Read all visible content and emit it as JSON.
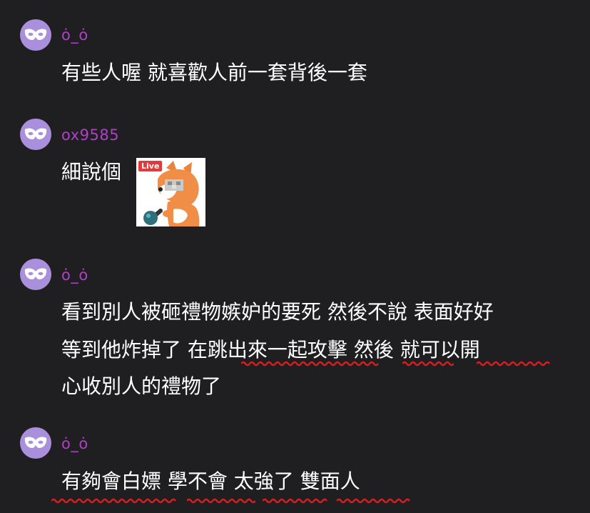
{
  "messages": [
    {
      "username": "ȯ_ȯ",
      "lines": [
        "有些人喔 就喜歡人前一套背後一套"
      ]
    },
    {
      "username": "ox9585",
      "lines": [
        "細說個"
      ],
      "sticker": {
        "badge": "Live",
        "icon": "fox-microphone-sticker"
      }
    },
    {
      "username": "ȯ_ȯ",
      "lines": [
        "看到別人被砸禮物嫉妒的要死 然後不說 表面好好",
        "等到他炸掉了 在跳出來一起攻擊 然後 就可以開",
        "心收別人的禮物了"
      ]
    },
    {
      "username": "ȯ_ȯ",
      "lines": [
        "有夠會白嫖 學不會 太強了 雙面人"
      ]
    }
  ],
  "colors": {
    "background": "#1f1f21",
    "username": "#b13fc9",
    "avatar": "#a98fdc",
    "underline": "#d61e1e"
  }
}
